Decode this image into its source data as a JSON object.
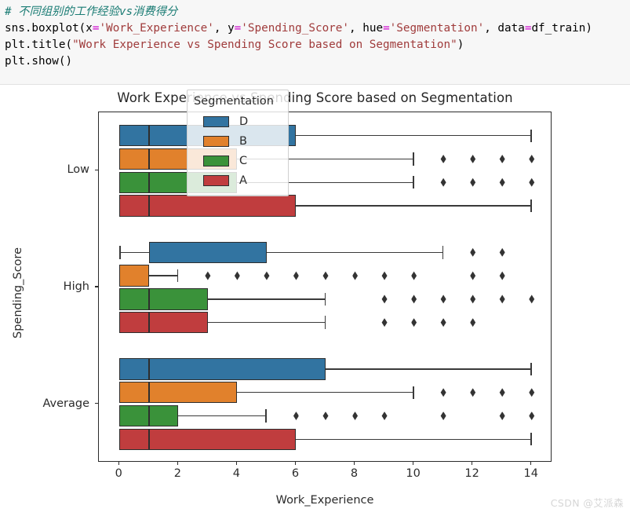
{
  "code_cell": {
    "lines": [
      [
        {
          "t": "comment",
          "s": "# 不同组别的工作经验vs消费得分"
        }
      ],
      [
        {
          "t": "plain",
          "s": "sns.boxplot("
        },
        {
          "t": "plain",
          "s": "x"
        },
        {
          "t": "op",
          "s": "="
        },
        {
          "t": "str",
          "s": "'Work_Experience'"
        },
        {
          "t": "plain",
          "s": ", "
        },
        {
          "t": "plain",
          "s": "y"
        },
        {
          "t": "op",
          "s": "="
        },
        {
          "t": "str",
          "s": "'Spending_Score'"
        },
        {
          "t": "plain",
          "s": ", "
        },
        {
          "t": "plain",
          "s": "hue"
        },
        {
          "t": "op",
          "s": "="
        },
        {
          "t": "str",
          "s": "'Segmentation'"
        },
        {
          "t": "plain",
          "s": ", "
        },
        {
          "t": "plain",
          "s": "data"
        },
        {
          "t": "op",
          "s": "="
        },
        {
          "t": "plain",
          "s": "df_train)"
        }
      ],
      [
        {
          "t": "plain",
          "s": "plt.title("
        },
        {
          "t": "str",
          "s": "\"Work Experience vs Spending Score based on Segmentation\""
        },
        {
          "t": "plain",
          "s": ")"
        }
      ],
      [
        {
          "t": "plain",
          "s": "plt.show()"
        }
      ]
    ]
  },
  "figure": {
    "watermark": "CSDN @艾派森"
  },
  "legend": {
    "title": "Segmentation",
    "entries": [
      {
        "label": "D",
        "color": "#3274a1"
      },
      {
        "label": "B",
        "color": "#e1812c"
      },
      {
        "label": "C",
        "color": "#3a923a"
      },
      {
        "label": "A",
        "color": "#c03d3e"
      }
    ]
  },
  "chart_data": {
    "type": "box",
    "orientation": "horizontal",
    "title": "Work Experience vs Spending Score based on Segmentation",
    "xlabel": "Work_Experience",
    "ylabel": "Spending_Score",
    "xlim": [
      -0.7,
      14.7
    ],
    "xticks": [
      0,
      2,
      4,
      6,
      8,
      10,
      12,
      14
    ],
    "categories": [
      "Low",
      "High",
      "Average"
    ],
    "hue_order": [
      "D",
      "B",
      "C",
      "A"
    ],
    "hue_colors": {
      "D": "#3274a1",
      "B": "#e1812c",
      "C": "#3a923a",
      "A": "#c03d3e"
    },
    "grid": false,
    "legend_position": "upper-center",
    "boxes": [
      {
        "category": "Low",
        "hue": "D",
        "q1": 0,
        "median": 1,
        "q3": 6,
        "whisker_low": 0,
        "whisker_high": 14,
        "fliers": []
      },
      {
        "category": "Low",
        "hue": "B",
        "q1": 0,
        "median": 1,
        "q3": 4,
        "whisker_low": 0,
        "whisker_high": 10,
        "fliers": [
          11,
          12,
          13,
          14
        ]
      },
      {
        "category": "Low",
        "hue": "C",
        "q1": 0,
        "median": 1,
        "q3": 4,
        "whisker_low": 0,
        "whisker_high": 10,
        "fliers": [
          11,
          12,
          13,
          14
        ]
      },
      {
        "category": "Low",
        "hue": "A",
        "q1": 0,
        "median": 1,
        "q3": 6,
        "whisker_low": 0,
        "whisker_high": 14,
        "fliers": []
      },
      {
        "category": "High",
        "hue": "D",
        "q1": 1,
        "median": 1,
        "q3": 5,
        "whisker_low": 0,
        "whisker_high": 11,
        "fliers": [
          12,
          13
        ]
      },
      {
        "category": "High",
        "hue": "B",
        "q1": 0,
        "median": 1,
        "q3": 1,
        "whisker_low": 0,
        "whisker_high": 2,
        "fliers": [
          3,
          4,
          5,
          6,
          7,
          8,
          9,
          10,
          12,
          13
        ]
      },
      {
        "category": "High",
        "hue": "C",
        "q1": 0,
        "median": 1,
        "q3": 3,
        "whisker_low": 0,
        "whisker_high": 7,
        "fliers": [
          9,
          10,
          11,
          12,
          13,
          14
        ]
      },
      {
        "category": "High",
        "hue": "A",
        "q1": 0,
        "median": 1,
        "q3": 3,
        "whisker_low": 0,
        "whisker_high": 7,
        "fliers": [
          9,
          10,
          11,
          12
        ]
      },
      {
        "category": "Average",
        "hue": "D",
        "q1": 0,
        "median": 1,
        "q3": 7,
        "whisker_low": 0,
        "whisker_high": 14,
        "fliers": []
      },
      {
        "category": "Average",
        "hue": "B",
        "q1": 0,
        "median": 1,
        "q3": 4,
        "whisker_low": 0,
        "whisker_high": 10,
        "fliers": [
          11,
          12,
          13,
          14
        ]
      },
      {
        "category": "Average",
        "hue": "C",
        "q1": 0,
        "median": 1,
        "q3": 2,
        "whisker_low": 0,
        "whisker_high": 5,
        "fliers": [
          6,
          7,
          8,
          9,
          11,
          13,
          14
        ]
      },
      {
        "category": "Average",
        "hue": "A",
        "q1": 0,
        "median": 1,
        "q3": 6,
        "whisker_low": 0,
        "whisker_high": 14,
        "fliers": []
      }
    ]
  }
}
